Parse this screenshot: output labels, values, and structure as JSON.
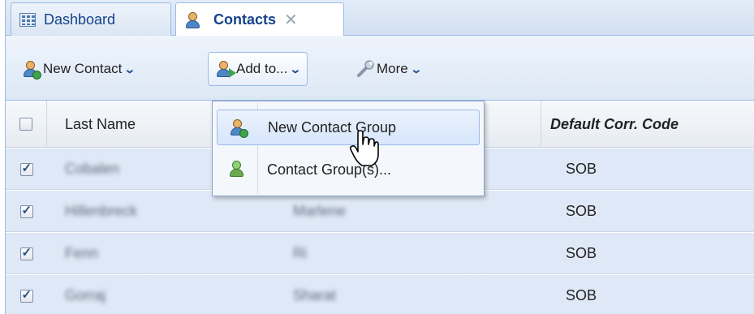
{
  "tabs": [
    {
      "label": "Dashboard",
      "icon": "dashboard-grid-icon"
    },
    {
      "label": "Contacts",
      "icon": "contacts-icon",
      "active": true,
      "closable": true
    }
  ],
  "toolbar": {
    "new_contact_label": "New Contact",
    "add_to_label": "Add to...",
    "more_label": "More"
  },
  "dropdown": {
    "items": [
      {
        "label": "New Contact Group",
        "icon": "new-group-icon",
        "hovered": true
      },
      {
        "label": "Contact Group(s)...",
        "icon": "contact-groups-icon"
      }
    ]
  },
  "grid": {
    "columns": [
      "Last Name",
      "",
      "Default Corr. Code"
    ],
    "rows": [
      {
        "checked": true,
        "last": "Cobalen",
        "first": "",
        "code": "SOB"
      },
      {
        "checked": true,
        "last": "Hillenbreck",
        "first": "Marlene",
        "code": "SOB"
      },
      {
        "checked": true,
        "last": "Fenn",
        "first": "Ri",
        "code": "SOB"
      },
      {
        "checked": true,
        "last": "Gorraj",
        "first": "Sharat",
        "code": "SOB"
      }
    ]
  },
  "colors": {
    "accent": "#15428b",
    "border": "#99bbe8",
    "row_selected": "#dfe8f6"
  }
}
